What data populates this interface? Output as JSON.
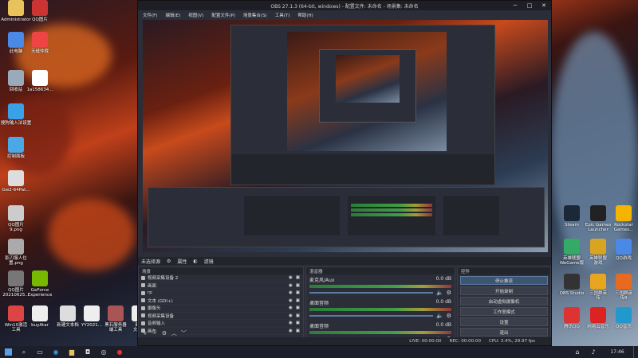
{
  "desktop_left": [
    {
      "label": "Administrator",
      "name": "admin-folder"
    },
    {
      "label": "QQ图片",
      "name": "qq-image"
    },
    {
      "label": "此电脑",
      "name": "this-pc"
    },
    {
      "label": "无缝仲裁",
      "name": "wufeng"
    },
    {
      "label": "回收站",
      "name": "recycle-bin"
    },
    {
      "label": "1a158634...",
      "name": "file-1a158634"
    },
    {
      "label": "搜狗输入法设置",
      "name": "sogou"
    },
    {
      "label": "控制面板",
      "name": "control-panel"
    },
    {
      "label": "Gw2-64Pat...",
      "name": "gw2"
    },
    {
      "label": "QQ图片\n9.png",
      "name": "qq-image-9"
    },
    {
      "label": "影刃服人位置.png",
      "name": "shadow-png"
    },
    {
      "label": "QQ图片\n20210625...",
      "name": "qq-image-2021"
    },
    {
      "label": "GeForce\nExperience",
      "name": "geforce"
    },
    {
      "label": "Win10激活\n工具",
      "name": "win10-tool"
    },
    {
      "label": "buyAtar",
      "name": "buyatar"
    },
    {
      "label": "新建文本档",
      "name": "new-text-1"
    },
    {
      "label": "YY2021...",
      "name": "yy2021"
    },
    {
      "label": "黑石服务器\n端工具",
      "name": "blackstone"
    },
    {
      "label": "新建\n文本...",
      "name": "new-text-2"
    }
  ],
  "desktop_right": [
    {
      "label": "Steam",
      "name": "steam"
    },
    {
      "label": "Epic Games\nLauncher",
      "name": "epic"
    },
    {
      "label": "Rockstar\nGames...",
      "name": "rockstar"
    },
    {
      "label": "英雄联盟\nWeGame版",
      "name": "lol"
    },
    {
      "label": "英雄联盟\n游戏",
      "name": "lol-game"
    },
    {
      "label": "QQ游戏",
      "name": "qq-game"
    },
    {
      "label": "OBS Studio",
      "name": "obs-studio"
    },
    {
      "label": "三国群英\n传",
      "name": "sanguo"
    },
    {
      "label": "三国群英\n传8",
      "name": "sanguo8"
    },
    {
      "label": "腾讯QQ",
      "name": "tencent-qq"
    },
    {
      "label": "网易云音乐",
      "name": "netease-music"
    },
    {
      "label": "QQ音乐",
      "name": "qq-music"
    }
  ],
  "obs": {
    "title": "OBS 27.1.3 (64-bit, windows) - 配置文件: 未命名 - 场景集: 未命名",
    "menu": [
      "文件(F)",
      "编辑(E)",
      "视图(V)",
      "配置文件(P)",
      "场景集合(S)",
      "工具(T)",
      "帮助(H)"
    ],
    "source_bar": {
      "label": "未选择源",
      "props": "属性",
      "filters": "滤镜"
    },
    "scenes_header": "场景",
    "sources": [
      {
        "label": "视频采集设备 2"
      },
      {
        "label": "画面"
      },
      {
        "label": "rp"
      },
      {
        "label": "文本 (GDI+)"
      },
      {
        "label": "摄像头"
      },
      {
        "label": "视频采集设备"
      },
      {
        "label": "音频输入"
      },
      {
        "label": "画布"
      }
    ],
    "mixer_header": "混音器",
    "mixer": [
      {
        "label": "麦克风/Aux",
        "db": "0.0 dB"
      },
      {
        "label": "桌面音频",
        "db": "0.0 dB"
      },
      {
        "label": "桌面音频",
        "db": "0.0 dB"
      }
    ],
    "controls_header": "控件",
    "controls": [
      {
        "label": "停止推流",
        "active": true
      },
      {
        "label": "开始录制",
        "active": false
      },
      {
        "label": "启动虚拟摄像机",
        "active": false
      },
      {
        "label": "工作室模式",
        "active": false
      },
      {
        "label": "设置",
        "active": false
      },
      {
        "label": "退出",
        "active": false
      }
    ],
    "status": {
      "live": "LIVE: 00:00:00",
      "rec": "REC: 00:00:00",
      "cpu": "CPU: 3.4%, 29.97 fps"
    }
  },
  "taskbar": {
    "time": "17:46"
  }
}
